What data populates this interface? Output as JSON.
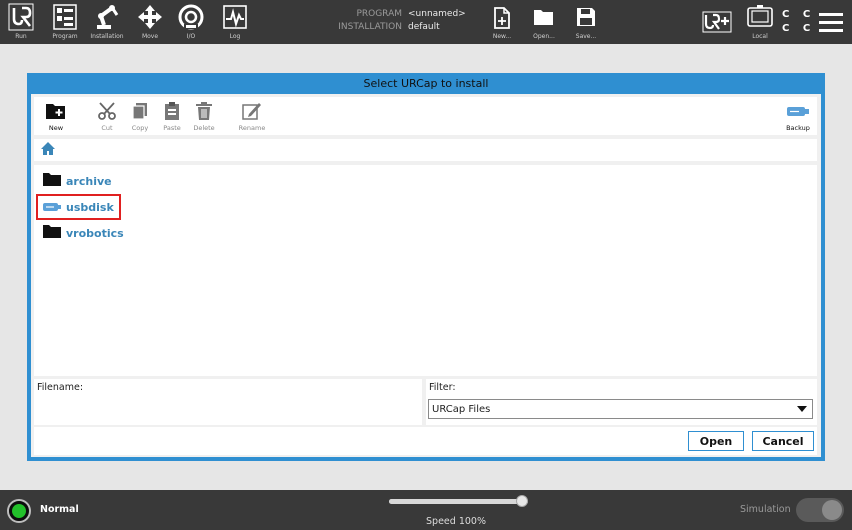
{
  "topbar": {
    "nav": [
      {
        "label": "Run",
        "icon": "ur-logo-icon"
      },
      {
        "label": "Program",
        "icon": "program-icon"
      },
      {
        "label": "Installation",
        "icon": "robot-arm-icon"
      },
      {
        "label": "Move",
        "icon": "move-arrows-icon"
      },
      {
        "label": "I/O",
        "icon": "io-icon"
      },
      {
        "label": "Log",
        "icon": "log-icon"
      }
    ],
    "program_key": "PROGRAM",
    "program_value": "<unnamed>",
    "installation_key": "INSTALLATION",
    "installation_value": "default",
    "file_buttons": [
      {
        "label": "New...",
        "icon": "new-file-icon"
      },
      {
        "label": "Open...",
        "icon": "open-folder-icon"
      },
      {
        "label": "Save...",
        "icon": "save-icon"
      }
    ],
    "urplus_icon": "ur-plus-icon",
    "local_label": "Local",
    "cc": [
      "C C",
      "C C"
    ],
    "menu_icon": "hamburger-menu-icon"
  },
  "dialog": {
    "title": "Select URCap to install",
    "toolbar": [
      {
        "label": "New",
        "icon": "new-folder-icon",
        "enabled": true
      },
      {
        "label": "Cut",
        "icon": "scissors-icon",
        "enabled": false
      },
      {
        "label": "Copy",
        "icon": "copy-icon",
        "enabled": false
      },
      {
        "label": "Paste",
        "icon": "paste-icon",
        "enabled": false
      },
      {
        "label": "Delete",
        "icon": "trash-icon",
        "enabled": false
      },
      {
        "label": "Rename",
        "icon": "rename-icon",
        "enabled": false
      },
      {
        "label": "Backup",
        "icon": "usb-backup-icon",
        "enabled": true
      }
    ],
    "path_icon": "home-icon",
    "files": [
      {
        "name": "archive",
        "icon": "folder-icon",
        "highlighted": false
      },
      {
        "name": "usbdisk",
        "icon": "usb-drive-icon",
        "highlighted": true
      },
      {
        "name": "vrobotics",
        "icon": "folder-icon",
        "highlighted": false
      }
    ],
    "filename_label": "Filename:",
    "filename_value": "",
    "filter_label": "Filter:",
    "filter_value": "URCap Files",
    "open_label": "Open",
    "cancel_label": "Cancel"
  },
  "bottombar": {
    "status": "Normal",
    "status_color": "#22c02a",
    "speed_label": "Speed 100%",
    "speed_fraction": 1.0,
    "simulation_label": "Simulation",
    "simulation_on": false
  }
}
